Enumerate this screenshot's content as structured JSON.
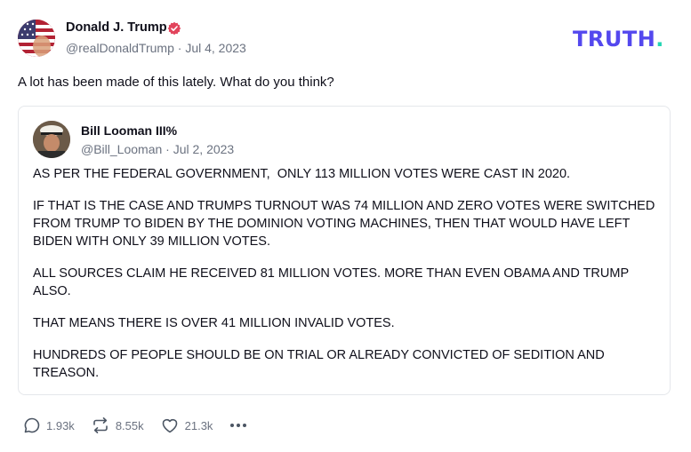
{
  "post": {
    "author_name": "Donald J. Trump",
    "author_handle": "@realDonaldTrump",
    "date": "Jul 4, 2023",
    "text": "A lot has been made of this lately. What do you think?",
    "logo_text": "TRUTH",
    "logo_dot": "."
  },
  "quote": {
    "author_name": "Bill Looman III%",
    "author_handle": "@Bill_Looman",
    "date": "Jul 2, 2023",
    "paragraphs": [
      "AS PER THE FEDERAL GOVERNMENT,  ONLY 113 MILLION VOTES WERE CAST IN 2020.",
      "IF THAT IS THE CASE AND TRUMPS TURNOUT WAS 74 MILLION AND ZERO VOTES WERE SWITCHED FROM TRUMP TO BIDEN BY THE DOMINION VOTING MACHINES, THEN THAT WOULD HAVE LEFT BIDEN WITH ONLY 39 MILLION VOTES.",
      "ALL SOURCES CLAIM HE RECEIVED 81 MILLION VOTES. MORE THAN EVEN OBAMA AND TRUMP ALSO.",
      "THAT MEANS THERE IS OVER 41 MILLION INVALID VOTES.",
      "HUNDREDS OF PEOPLE SHOULD BE ON TRIAL OR ALREADY CONVICTED OF SEDITION AND TREASON."
    ]
  },
  "actions": {
    "replies": "1.93k",
    "retruths": "8.55k",
    "likes": "21.3k"
  },
  "colors": {
    "brand": "#5448ee",
    "brand_accent": "#23d5b3",
    "verified": "#e2445c",
    "muted_text": "#6b7280"
  },
  "icons": {
    "verified": "verified-badge-icon",
    "reply": "reply-bubble-icon",
    "retruth": "retruth-arrows-icon",
    "like": "heart-icon",
    "more": "more-dots-icon"
  }
}
